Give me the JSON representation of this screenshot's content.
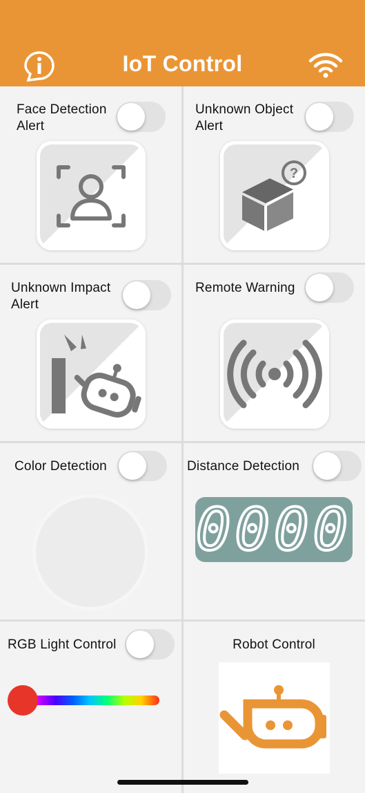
{
  "header": {
    "title": "IoT Control",
    "info_icon": "info-icon",
    "wifi_icon": "wifi-icon",
    "accent_color": "#ea9535"
  },
  "panels": {
    "face_detection": {
      "label_line1": "Face Detection",
      "label_line2": "Alert",
      "toggle_on": false,
      "icon": "face-scan-icon"
    },
    "unknown_object": {
      "label_line1": "Unknown Object",
      "label_line2": "Alert",
      "toggle_on": false,
      "icon": "unknown-box-icon",
      "badge": "?"
    },
    "unknown_impact": {
      "label_line1": "Unknown Impact",
      "label_line2": "Alert",
      "toggle_on": false,
      "icon": "robot-impact-icon"
    },
    "remote_warning": {
      "label": "Remote Warning",
      "toggle_on": false,
      "icon": "broadcast-icon"
    },
    "color_detection": {
      "label": "Color Detection",
      "toggle_on": false
    },
    "distance_detection": {
      "label": "Distance Detection",
      "toggle_on": false,
      "display_value": "0000",
      "display_color": "#7fa19e"
    },
    "rgb_light": {
      "label": "RGB Light Control",
      "toggle_on": false,
      "slider_value": 0,
      "thumb_color": "#e8352a"
    },
    "robot_control": {
      "label": "Robot Control",
      "icon": "robot-head-icon",
      "icon_color": "#ea9535"
    }
  }
}
